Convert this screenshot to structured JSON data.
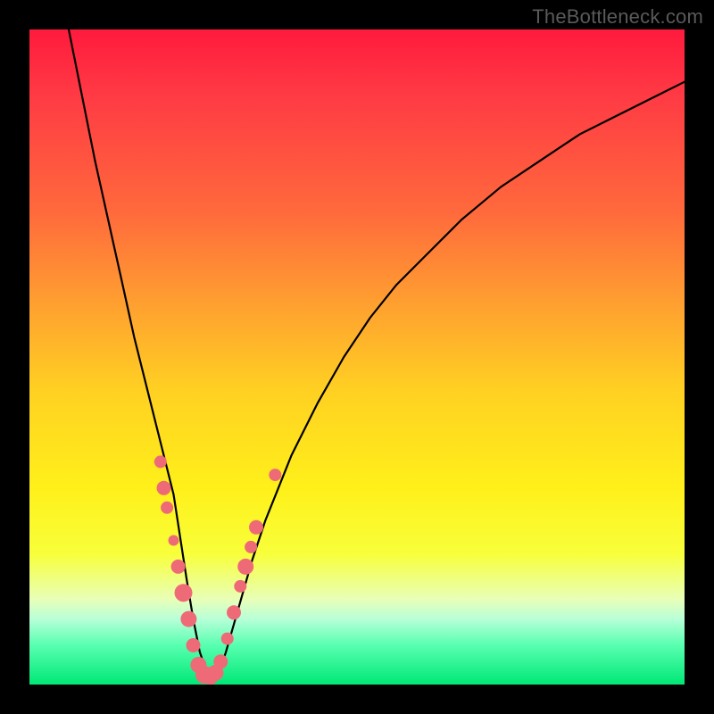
{
  "watermark": "TheBottleneck.com",
  "colors": {
    "frame": "#000000",
    "gradient_stops": [
      {
        "pos": 0.0,
        "color": "#ff1a3d"
      },
      {
        "pos": 0.1,
        "color": "#ff3a44"
      },
      {
        "pos": 0.28,
        "color": "#ff6a3c"
      },
      {
        "pos": 0.42,
        "color": "#ffa030"
      },
      {
        "pos": 0.55,
        "color": "#ffd022"
      },
      {
        "pos": 0.7,
        "color": "#fff01a"
      },
      {
        "pos": 0.8,
        "color": "#f8ff3a"
      },
      {
        "pos": 0.87,
        "color": "#e8ffb8"
      },
      {
        "pos": 0.9,
        "color": "#b8ffd8"
      },
      {
        "pos": 0.94,
        "color": "#58ffb0"
      },
      {
        "pos": 1.0,
        "color": "#00e876"
      }
    ],
    "curve_stroke": "#000000",
    "marker_fill": "#ef6a77",
    "marker_stroke": "#ef6a77"
  },
  "chart_data": {
    "type": "line",
    "title": "",
    "xlabel": "",
    "ylabel": "",
    "xlim": [
      0,
      100
    ],
    "ylim": [
      0,
      100
    ],
    "grid": false,
    "legend": false,
    "annotations": [],
    "series": [
      {
        "name": "bottleneck-curve",
        "comment": "V-shaped curve; y ≈ 100 is top, y ≈ 0 is bottom (green band). Minimum near x≈27.",
        "x": [
          6,
          8,
          10,
          12,
          14,
          16,
          18,
          20,
          22,
          24,
          25,
          26,
          27,
          28,
          29,
          30,
          32,
          34,
          36,
          38,
          40,
          44,
          48,
          52,
          56,
          60,
          66,
          72,
          78,
          84,
          90,
          96,
          100
        ],
        "y": [
          100,
          90,
          80,
          71,
          62,
          53,
          45,
          37,
          29,
          16,
          10,
          5,
          2,
          1,
          2,
          5,
          12,
          19,
          25,
          30,
          35,
          43,
          50,
          56,
          61,
          65,
          71,
          76,
          80,
          84,
          87,
          90,
          92
        ]
      }
    ],
    "markers": [
      {
        "name": "left-cluster",
        "x": 20.0,
        "y": 34,
        "r": 7
      },
      {
        "name": "left-cluster",
        "x": 20.5,
        "y": 30,
        "r": 8
      },
      {
        "name": "left-cluster",
        "x": 21.0,
        "y": 27,
        "r": 7
      },
      {
        "name": "left-cluster",
        "x": 22.0,
        "y": 22,
        "r": 6
      },
      {
        "name": "left-cluster",
        "x": 22.7,
        "y": 18,
        "r": 8
      },
      {
        "name": "left-cluster",
        "x": 23.5,
        "y": 14,
        "r": 10
      },
      {
        "name": "left-cluster",
        "x": 24.3,
        "y": 10,
        "r": 9
      },
      {
        "name": "trough",
        "x": 25.0,
        "y": 6,
        "r": 8
      },
      {
        "name": "trough",
        "x": 25.8,
        "y": 3,
        "r": 9
      },
      {
        "name": "trough",
        "x": 26.7,
        "y": 1.5,
        "r": 10
      },
      {
        "name": "trough",
        "x": 27.6,
        "y": 1.2,
        "r": 9
      },
      {
        "name": "trough",
        "x": 28.4,
        "y": 1.8,
        "r": 9
      },
      {
        "name": "trough",
        "x": 29.2,
        "y": 3.5,
        "r": 8
      },
      {
        "name": "right-cluster",
        "x": 30.2,
        "y": 7,
        "r": 7
      },
      {
        "name": "right-cluster",
        "x": 31.2,
        "y": 11,
        "r": 8
      },
      {
        "name": "right-cluster",
        "x": 32.2,
        "y": 15,
        "r": 7
      },
      {
        "name": "right-cluster",
        "x": 33.0,
        "y": 18,
        "r": 9
      },
      {
        "name": "right-cluster",
        "x": 33.8,
        "y": 21,
        "r": 7
      },
      {
        "name": "right-cluster",
        "x": 34.6,
        "y": 24,
        "r": 8
      },
      {
        "name": "right-outlier",
        "x": 37.5,
        "y": 32,
        "r": 7
      }
    ]
  }
}
